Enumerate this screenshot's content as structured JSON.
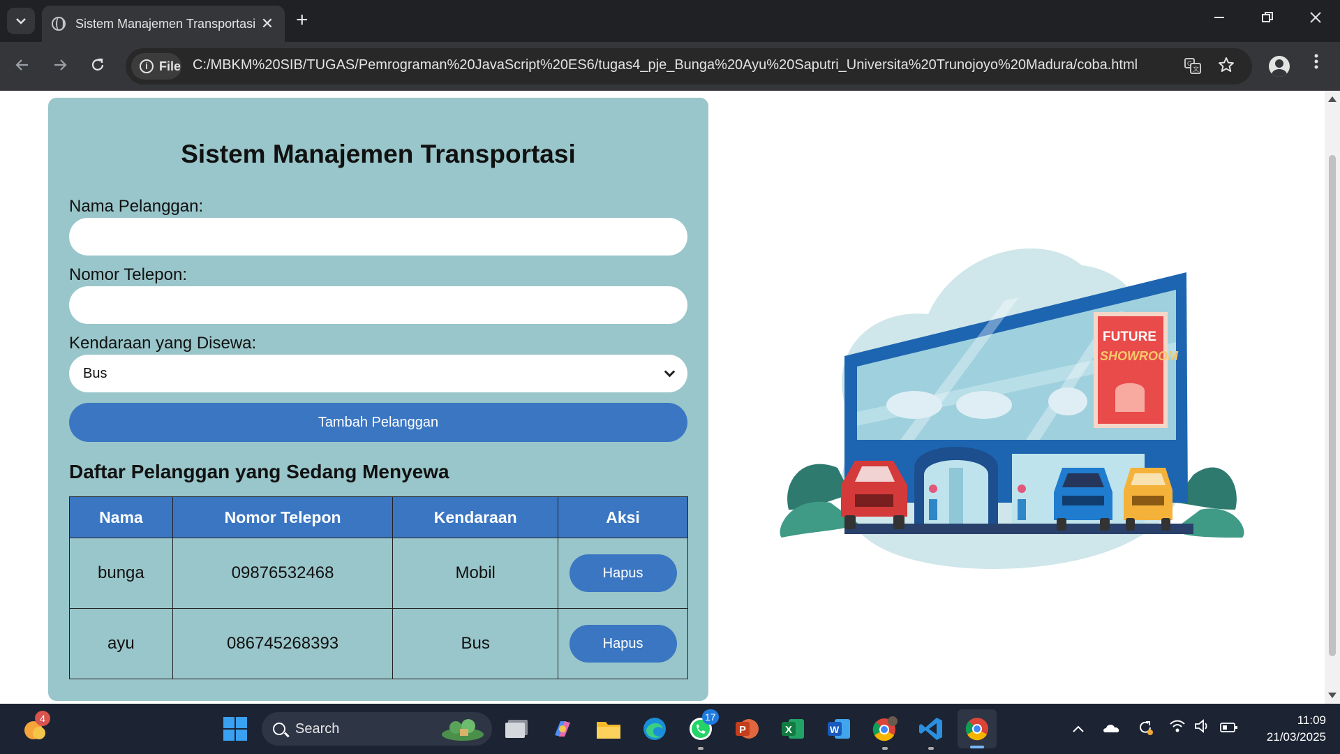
{
  "browser": {
    "tab_title": "Sistem Manajemen Transportasi",
    "tab_close": "✕",
    "new_tab": "+",
    "scheme_chip": "File",
    "url": "C:/MBKM%20SIB/TUGAS/Pemrograman%20JavaScript%20ES6/tugas4_pje_Bunga%20Ayu%20Saputri_Universita%20Trunojoyo%20Madura/coba.html",
    "icons": [
      "tab-search-icon",
      "back-icon",
      "forward-icon",
      "reload-icon",
      "info-icon",
      "translate-icon",
      "bookmark-star-icon",
      "profile-icon",
      "menu-icon",
      "minimize-icon",
      "restore-icon",
      "close-icon"
    ]
  },
  "page": {
    "heading": "Sistem Manajemen Transportasi",
    "form": {
      "name_label": "Nama Pelanggan:",
      "name_value": "",
      "phone_label": "Nomor Telepon:",
      "phone_value": "",
      "vehicle_label": "Kendaraan yang Disewa:",
      "vehicle_selected": "Bus",
      "submit_label": "Tambah Pelanggan"
    },
    "list_heading": "Daftar Pelanggan yang Sedang Menyewa",
    "table": {
      "headers": [
        "Nama",
        "Nomor Telepon",
        "Kendaraan",
        "Aksi"
      ],
      "rows": [
        {
          "nama": "bunga",
          "telepon": "09876532468",
          "kendaraan": "Mobil",
          "aksi": "Hapus"
        },
        {
          "nama": "ayu",
          "telepon": "086745268393",
          "kendaraan": "Bus",
          "aksi": "Hapus"
        }
      ]
    },
    "illustration": {
      "sign_line1": "FUTURE",
      "sign_line2": "SHOWROOM"
    },
    "colors": {
      "card_bg": "#99c6ca",
      "accent": "#3a76c2"
    }
  },
  "taskbar": {
    "weather_badge": "4",
    "search_label": "Search",
    "whatsapp_badge": "17",
    "time": "11:09",
    "date": "21/03/2025",
    "apps": [
      "widgets-icon",
      "start-icon",
      "search-icon",
      "task-view-icon",
      "copilot-icon",
      "file-explorer-icon",
      "edge-icon",
      "whatsapp-icon",
      "powerpoint-icon",
      "excel-icon",
      "word-icon",
      "chrome-profile-icon",
      "vscode-icon",
      "chrome-icon"
    ],
    "tray_icons": [
      "chevron-up-icon",
      "onedrive-icon",
      "sync-icon",
      "wifi-icon",
      "volume-icon",
      "battery-icon"
    ]
  }
}
